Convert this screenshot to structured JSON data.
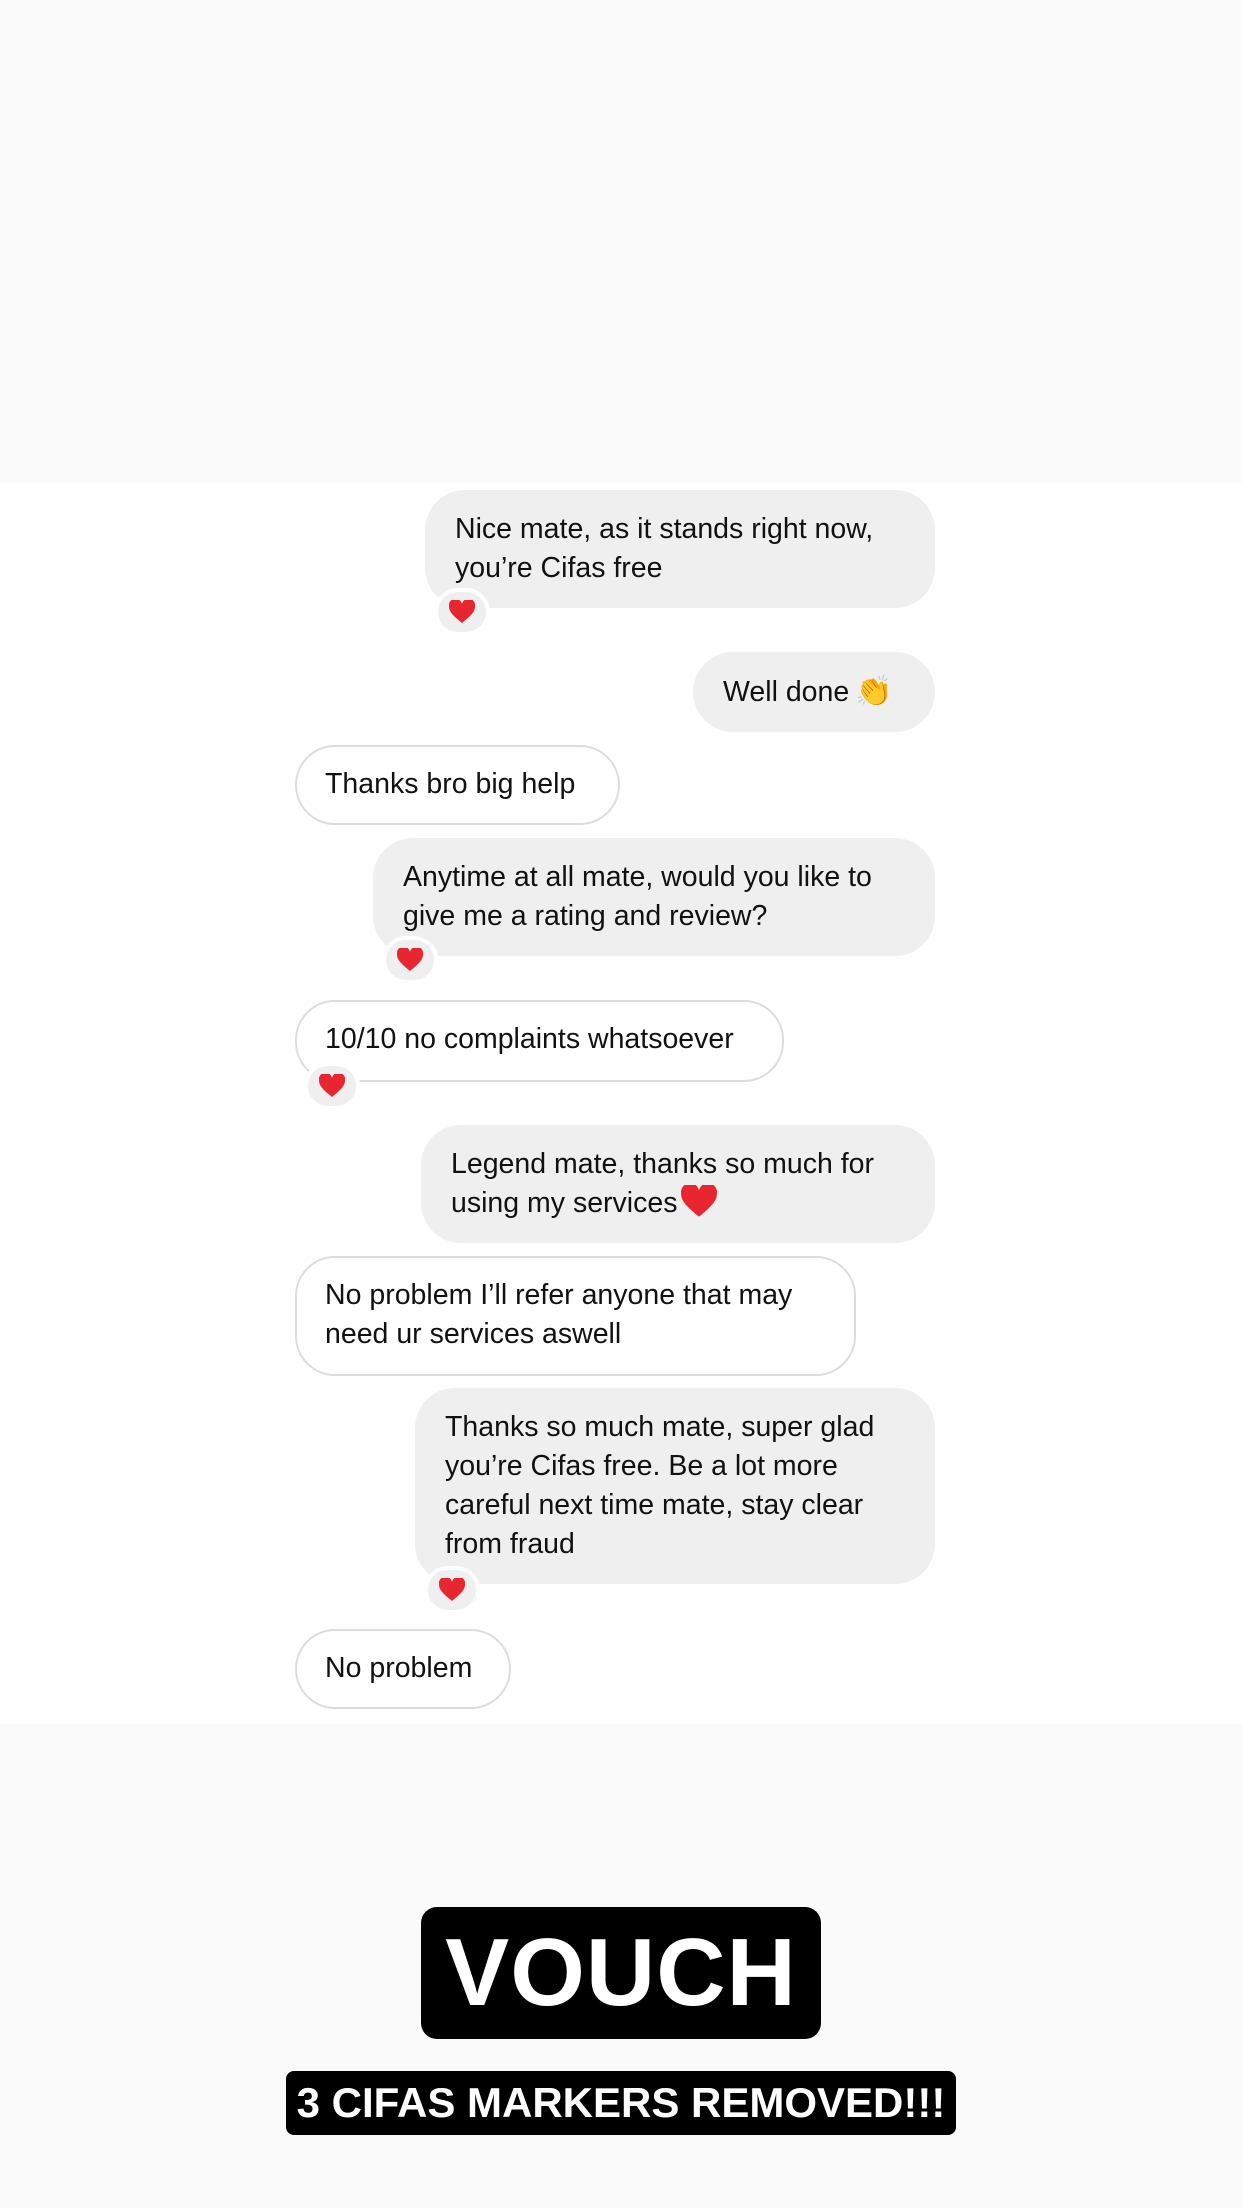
{
  "messages": [
    {
      "text_lines": [
        "Nice mate, as it stands right now,",
        "you’re Cifas free"
      ],
      "side": "sent",
      "reaction": "heart"
    },
    {
      "text": "Well done",
      "side": "sent",
      "emoji": "clapping-hands"
    },
    {
      "text": "Thanks bro big help",
      "side": "received"
    },
    {
      "text_lines": [
        "Anytime at all mate, would you like to",
        "give me a rating and review?"
      ],
      "side": "sent",
      "reaction": "heart"
    },
    {
      "text": "10/10 no complaints whatsoever",
      "side": "received",
      "reaction": "heart"
    },
    {
      "text_lines": [
        "Legend mate, thanks so much for",
        "using my services"
      ],
      "side": "sent",
      "emoji": "heart"
    },
    {
      "text_lines": [
        "No problem I’ll refer anyone that may",
        "need ur services aswell"
      ],
      "side": "received"
    },
    {
      "text_lines": [
        "Thanks so much mate, super glad",
        "you’re Cifas free. Be a lot more",
        "careful next time mate, stay clear",
        "from fraud"
      ],
      "side": "sent",
      "reaction": "heart"
    },
    {
      "text": "No problem",
      "side": "received"
    }
  ],
  "overlay": {
    "headline": "VOUCH",
    "tagline": "3 CIFAS MARKERS REMOVED!!!"
  },
  "colors": {
    "sent_bubble": "#efefef",
    "received_border": "#dcdcdc",
    "heart": "#e8262f",
    "overlay_bg": "#000000"
  },
  "icons": {
    "clap": "👏"
  }
}
